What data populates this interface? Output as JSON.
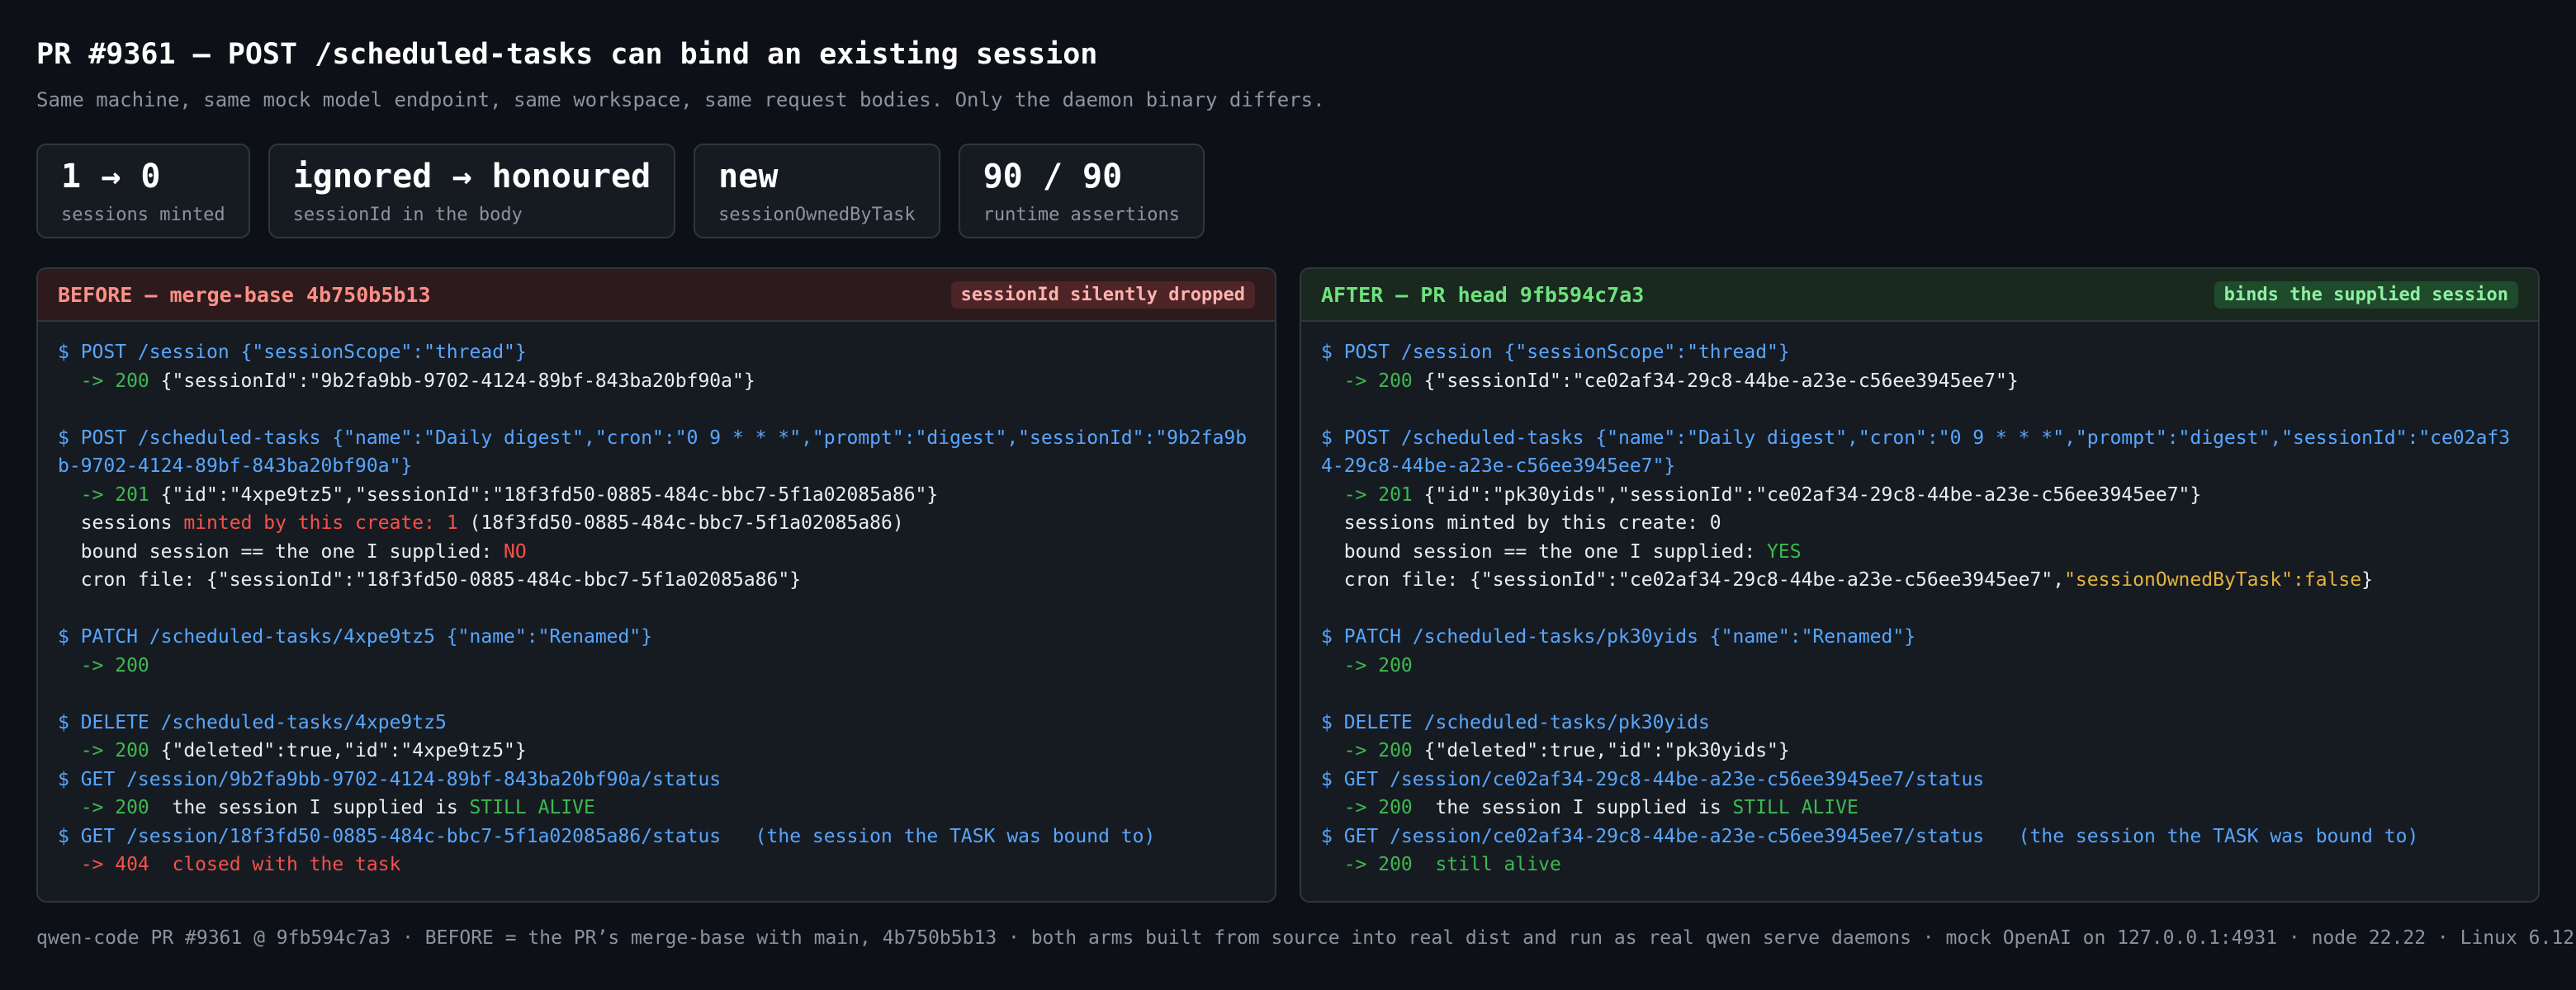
{
  "header": {
    "title": "PR #9361 — POST /scheduled-tasks can bind an existing session",
    "subtitle": "Same machine, same mock model endpoint, same workspace, same request bodies. Only the daemon binary differs."
  },
  "stats": [
    {
      "value": "1 → 0",
      "label": "sessions minted"
    },
    {
      "value": "ignored → honoured",
      "label": "sessionId in the body"
    },
    {
      "value": "new",
      "label": "sessionOwnedByTask"
    },
    {
      "value": "90 / 90",
      "label": "runtime assertions"
    }
  ],
  "before": {
    "title": "BEFORE — merge-base 4b750b5b13",
    "badge": "sessionId silently dropped",
    "l1": "$ POST /session {\"sessionScope\":\"thread\"}",
    "l2a": "  -> 200 ",
    "l2b": "{\"sessionId\":\"9b2fa9bb-9702-4124-89bf-843ba20bf90a\"}",
    "l3": "$ POST /scheduled-tasks {\"name\":\"Daily digest\",\"cron\":\"0 9 * * *\",\"prompt\":\"digest\",\"sessionId\":\"9b2fa9bb-9702-4124-89bf-843ba20bf90a\"}",
    "l4a": "  -> 201 ",
    "l4b": "{\"id\":\"4xpe9tz5\",\"sessionId\":\"18f3fd50-0885-484c-bbc7-5f1a02085a86\"}",
    "l5a": "  sessions ",
    "l5b": "minted by this create: 1",
    "l5c": " (18f3fd50-0885-484c-bbc7-5f1a02085a86)",
    "l6a": "  bound session == the one I supplied: ",
    "l6b": "NO",
    "l7": "  cron file: {\"sessionId\":\"18f3fd50-0885-484c-bbc7-5f1a02085a86\"}",
    "l8": "$ PATCH /scheduled-tasks/4xpe9tz5 {\"name\":\"Renamed\"}",
    "l9": "  -> 200",
    "l10": "$ DELETE /scheduled-tasks/4xpe9tz5",
    "l11a": "  -> 200 ",
    "l11b": "{\"deleted\":true,\"id\":\"4xpe9tz5\"}",
    "l12": "$ GET /session/9b2fa9bb-9702-4124-89bf-843ba20bf90a/status",
    "l13a": "  -> 200  ",
    "l13b": "the session I supplied is ",
    "l13c": "STILL ALIVE",
    "l14": "$ GET /session/18f3fd50-0885-484c-bbc7-5f1a02085a86/status   (the session the TASK was bound to)",
    "l15": "  -> 404  closed with the task"
  },
  "after": {
    "title": "AFTER — PR head 9fb594c7a3",
    "badge": "binds the supplied session",
    "l1": "$ POST /session {\"sessionScope\":\"thread\"}",
    "l2a": "  -> 200 ",
    "l2b": "{\"sessionId\":\"ce02af34-29c8-44be-a23e-c56ee3945ee7\"}",
    "l3": "$ POST /scheduled-tasks {\"name\":\"Daily digest\",\"cron\":\"0 9 * * *\",\"prompt\":\"digest\",\"sessionId\":\"ce02af34-29c8-44be-a23e-c56ee3945ee7\"}",
    "l4a": "  -> 201 ",
    "l4b": "{\"id\":\"pk30yids\",\"sessionId\":\"ce02af34-29c8-44be-a23e-c56ee3945ee7\"}",
    "l5": "  sessions minted by this create: 0",
    "l6a": "  bound session == the one I supplied: ",
    "l6b": "YES",
    "l7a": "  cron file: {\"sessionId\":\"ce02af34-29c8-44be-a23e-c56ee3945ee7\",",
    "l7b": "\"sessionOwnedByTask\":false",
    "l7c": "}",
    "l8": "$ PATCH /scheduled-tasks/pk30yids {\"name\":\"Renamed\"}",
    "l9": "  -> 200",
    "l10": "$ DELETE /scheduled-tasks/pk30yids",
    "l11a": "  -> 200 ",
    "l11b": "{\"deleted\":true,\"id\":\"pk30yids\"}",
    "l12": "$ GET /session/ce02af34-29c8-44be-a23e-c56ee3945ee7/status",
    "l13a": "  -> 200  ",
    "l13b": "the session I supplied is ",
    "l13c": "STILL ALIVE",
    "l14": "$ GET /session/ce02af34-29c8-44be-a23e-c56ee3945ee7/status   (the session the TASK was bound to)",
    "l15": "  -> 200  still alive"
  },
  "footer": "qwen-code PR #9361 @ 9fb594c7a3 · BEFORE = the PR’s merge-base with main, 4b750b5b13 · both arms built from source into real dist and run as real qwen serve daemons · mock OpenAI on 127.0.0.1:4931 · node 22.22 · Linux 6.12",
  "colors": {
    "background": "#0d1117",
    "command": "#58a6ff",
    "ok": "#3fb950",
    "error": "#f85149",
    "highlight": "#e3b341"
  }
}
